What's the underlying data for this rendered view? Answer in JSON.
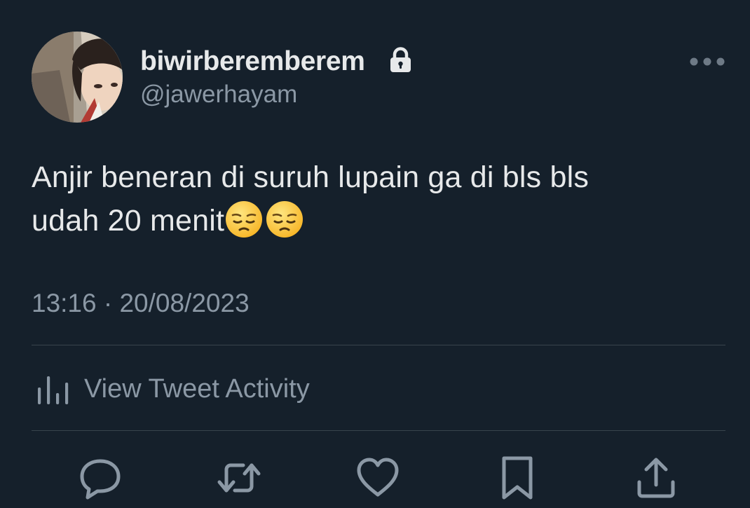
{
  "colors": {
    "background": "#15202b",
    "primary_text": "#e7e9ea",
    "secondary_text": "#8b98a5",
    "divider": "#38444d",
    "icon": "#8b98a5"
  },
  "author": {
    "display_name": "biwirberemberem",
    "handle": "@jawerhayam",
    "protected_icon": "lock-icon",
    "avatar": "profile-photo"
  },
  "header": {
    "more_icon": "more-options-icon"
  },
  "tweet": {
    "lines": [
      "Anjir beneran di suruh lupain ga di bls bls",
      "udah 20 menit"
    ],
    "emojis": [
      "pensive-face-emoji",
      "pensive-face-emoji"
    ],
    "timestamp": "13:16 · 20/08/2023"
  },
  "activity": {
    "icon": "analytics-icon",
    "label": "View Tweet Activity"
  },
  "actions": [
    {
      "name": "reply",
      "icon": "reply-icon"
    },
    {
      "name": "retweet",
      "icon": "retweet-icon"
    },
    {
      "name": "like",
      "icon": "heart-icon"
    },
    {
      "name": "bookmark",
      "icon": "bookmark-icon"
    },
    {
      "name": "share",
      "icon": "share-icon"
    }
  ]
}
